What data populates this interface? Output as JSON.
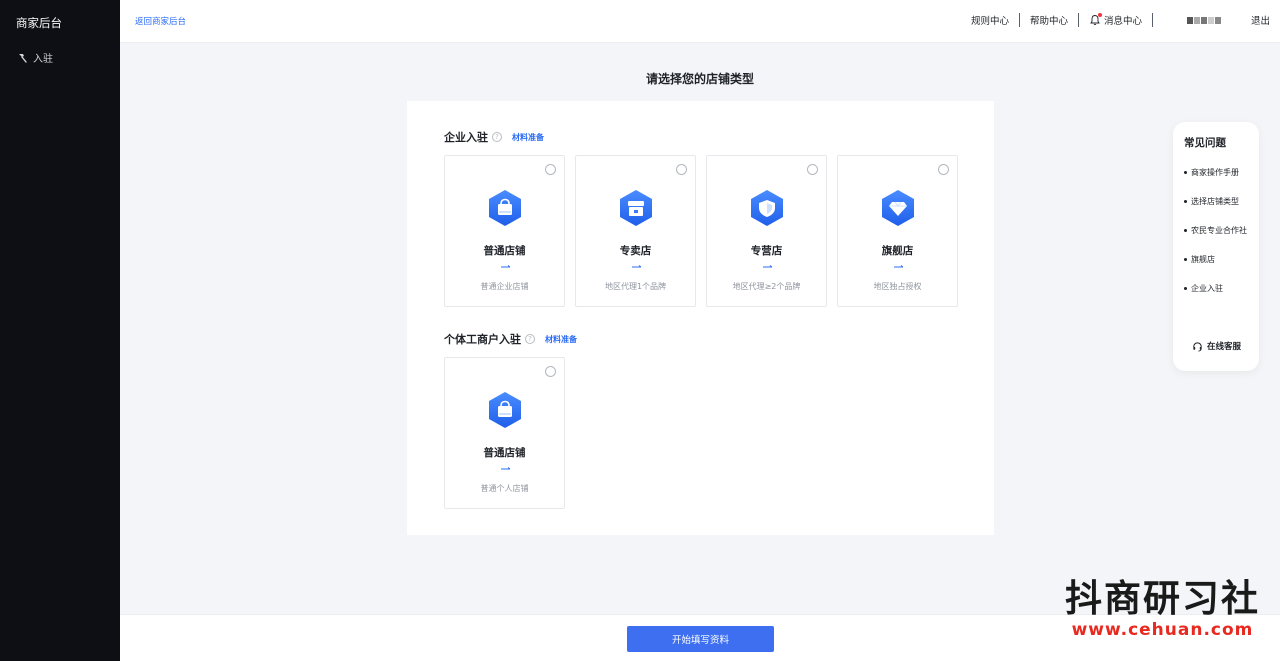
{
  "sidebar": {
    "brand": "商家后台",
    "items": [
      {
        "label": "入驻",
        "icon": "hammer-icon"
      }
    ]
  },
  "header": {
    "back_label": "返回商家后台",
    "nav": {
      "rules": "规则中心",
      "help": "帮助中心",
      "messages": "消息中心",
      "logout": "退出"
    }
  },
  "main": {
    "title": "请选择您的店铺类型",
    "sections": [
      {
        "title": "企业入驻",
        "link": "材料准备",
        "cards": [
          {
            "title": "普通店铺",
            "desc": "普通企业店铺",
            "icon": "bag-icon"
          },
          {
            "title": "专卖店",
            "desc": "地区代理1个品牌",
            "icon": "store-icon"
          },
          {
            "title": "专营店",
            "desc": "地区代理≥2个品牌",
            "icon": "shield-icon"
          },
          {
            "title": "旗舰店",
            "desc": "地区独占授权",
            "icon": "diamond-icon"
          }
        ]
      },
      {
        "title": "个体工商户入驻",
        "link": "材料准备",
        "cards": [
          {
            "title": "普通店铺",
            "desc": "普通个人店铺",
            "icon": "bag-icon"
          }
        ]
      }
    ]
  },
  "faq": {
    "title": "常见问题",
    "items": [
      "商家操作手册",
      "选择店铺类型",
      "农民专业合作社",
      "旗舰店",
      "企业入驻"
    ],
    "service": "在线客服"
  },
  "footer": {
    "submit_label": "开始填写资料"
  },
  "watermark": {
    "title": "抖商研习社",
    "url": "www.cehuan.com"
  },
  "colors": {
    "accent": "#2b6cf6",
    "button": "#3e6ff1",
    "sidebar_bg": "#0d0f14",
    "watermark_url": "#e8291f"
  }
}
